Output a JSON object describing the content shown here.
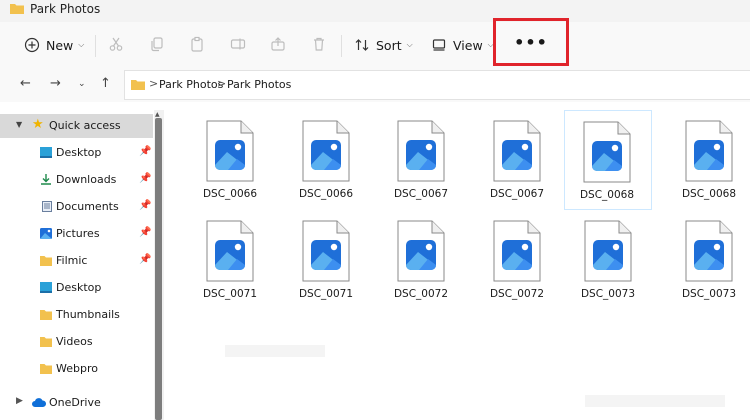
{
  "window": {
    "title": "Park Photos"
  },
  "toolbar": {
    "new_label": "New",
    "sort_label": "Sort",
    "view_label": "View",
    "more_label": "•••",
    "icons": [
      "new-icon",
      "cut-icon",
      "copy-icon",
      "paste-icon",
      "rename-icon",
      "share-icon",
      "delete-icon",
      "sort-icon",
      "view-icon"
    ]
  },
  "address": {
    "crumbs": [
      "Park Photos",
      "Park Photos"
    ],
    "separator": ">"
  },
  "sidebar": {
    "quick_access": "Quick access",
    "items": [
      {
        "label": "Desktop",
        "icon": "desktop-icon",
        "pinned": true
      },
      {
        "label": "Downloads",
        "icon": "downloads-icon",
        "pinned": true
      },
      {
        "label": "Documents",
        "icon": "documents-icon",
        "pinned": true
      },
      {
        "label": "Pictures",
        "icon": "pictures-icon",
        "pinned": true
      },
      {
        "label": "Filmic",
        "icon": "folder-icon",
        "pinned": true
      },
      {
        "label": "Desktop",
        "icon": "desktop-icon",
        "pinned": false
      },
      {
        "label": "Thumbnails",
        "icon": "folder-icon",
        "pinned": false
      },
      {
        "label": "Videos",
        "icon": "folder-icon",
        "pinned": false
      },
      {
        "label": "Webpro",
        "icon": "folder-icon",
        "pinned": false
      }
    ],
    "onedrive": "OneDrive"
  },
  "files": [
    {
      "name": "DSC_0066"
    },
    {
      "name": "DSC_0066"
    },
    {
      "name": "DSC_0067"
    },
    {
      "name": "DSC_0067"
    },
    {
      "name": "DSC_0068",
      "selected": true
    },
    {
      "name": "DSC_0068"
    },
    {
      "name": "DSC_0071"
    },
    {
      "name": "DSC_0071"
    },
    {
      "name": "DSC_0072"
    },
    {
      "name": "DSC_0072"
    },
    {
      "name": "DSC_0073"
    },
    {
      "name": "DSC_0073"
    }
  ],
  "colors": {
    "highlight_box": "#e0242b",
    "folder": "#f2c14e",
    "image_icon_blue": "#1f6fd8",
    "image_icon_light": "#5ab0f0"
  }
}
